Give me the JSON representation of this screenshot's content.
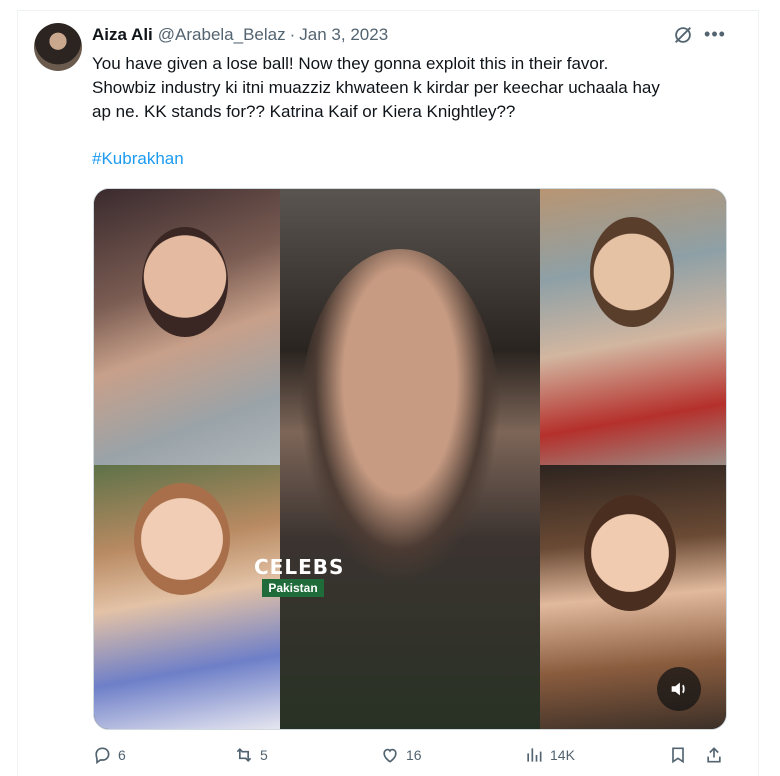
{
  "tweet": {
    "author_name": "Aiza Ali",
    "author_handle": "@Arabela_Belaz",
    "separator": "·",
    "date": "Jan 3, 2023",
    "more_label": "•••",
    "text_lines": [
      "You have given a lose ball! Now they gonna exploit this in their favor.",
      "Showbiz industry ki itni muazziz khwateen k kirdar per keechar uchaala hay",
      "ap ne. KK stands for?? Katrina Kaif or Kiera Knightley??"
    ],
    "hashtag": "#Kubrakhan"
  },
  "media": {
    "watermark_top": "CELEBS",
    "watermark_bottom": "Pakistan",
    "icons": [
      "sound-icon"
    ]
  },
  "actions": {
    "replies": "6",
    "retweets": "5",
    "likes": "16",
    "views": "14K",
    "icons": [
      "reply-icon",
      "retweet-icon",
      "like-icon",
      "views-icon",
      "bookmark-icon",
      "share-icon"
    ]
  },
  "colors": {
    "link": "#1d9bf0",
    "secondary_text": "#536471",
    "primary_text": "#0f1419",
    "watermark_bg": "#1f6b3a"
  }
}
